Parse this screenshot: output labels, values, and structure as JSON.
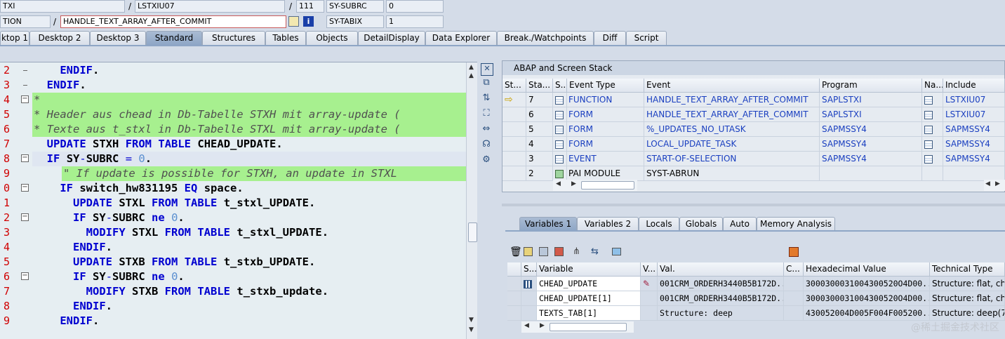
{
  "header": {
    "row1": {
      "f1": "TXI",
      "sep1": "/",
      "f2": "LSTXIU07",
      "sep2": "/",
      "f3": "111",
      "f4": "SY-SUBRC",
      "f5": "0"
    },
    "row2": {
      "f1": "TION",
      "sep1": "/",
      "f2": "HANDLE_TEXT_ARRAY_AFTER_COMMIT",
      "f4": "SY-TABIX",
      "f5": "1"
    }
  },
  "tabs": [
    "ktop 1",
    "Desktop 2",
    "Desktop 3",
    "Standard",
    "Structures",
    "Tables",
    "Objects",
    "DetailDisplay",
    "Data Explorer",
    "Break./Watchpoints",
    "Diff",
    "Script"
  ],
  "active_tab": "Standard",
  "editor": {
    "line_numbers": [
      "2",
      "3",
      "4",
      "5",
      "6",
      "7",
      "8",
      "9",
      "0",
      "1",
      "2",
      "3",
      "4",
      "5",
      "6",
      "7",
      "8",
      "9"
    ],
    "lines": [
      {
        "text": "    ENDIF."
      },
      {
        "text": "  ENDIF."
      },
      {
        "text": "*"
      },
      {
        "text": "* Header aus chead in Db-Tabelle STXH mit array-update ("
      },
      {
        "text": "* Texte aus t_stxl in Db-Tabelle STXL mit array-update ("
      },
      {
        "text": "  UPDATE STXH FROM TABLE CHEAD_UPDATE."
      },
      {
        "text": "  IF SY-SUBRC = 0."
      },
      {
        "text": "    \" If update is possible for STXH, an update in STXL"
      },
      {
        "text": "    IF switch_hw831195 EQ space."
      },
      {
        "text": "      UPDATE STXL FROM TABLE t_stxl_UPDATE."
      },
      {
        "text": "      IF SY-SUBRC ne 0."
      },
      {
        "text": "        MODIFY STXL FROM TABLE t_stxl_UPDATE."
      },
      {
        "text": "      ENDIF."
      },
      {
        "text": "      UPDATE STXB FROM TABLE t_stxb_UPDATE."
      },
      {
        "text": "      IF SY-SUBRC ne 0."
      },
      {
        "text": "        MODIFY STXB FROM TABLE t_stxb_update."
      },
      {
        "text": "      ENDIF."
      },
      {
        "text": "    ENDIF."
      }
    ]
  },
  "stack": {
    "title": "ABAP and Screen Stack",
    "headers": [
      "St...",
      "Sta...",
      "S...",
      "Event Type",
      "Event",
      "Program",
      "Na...",
      "Include"
    ],
    "rows": [
      {
        "level": "7",
        "type": "FUNCTION",
        "event": "HANDLE_TEXT_ARRAY_AFTER_COMMIT",
        "program": "SAPLSTXI",
        "include": "LSTXIU07",
        "current": true
      },
      {
        "level": "6",
        "type": "FORM",
        "event": "HANDLE_TEXT_ARRAY_AFTER_COMMIT",
        "program": "SAPLSTXI",
        "include": "LSTXIU07"
      },
      {
        "level": "5",
        "type": "FORM",
        "event": "%_UPDATES_NO_UTASK",
        "program": "SAPMSSY4",
        "include": "SAPMSSY4"
      },
      {
        "level": "4",
        "type": "FORM",
        "event": "LOCAL_UPDATE_TASK",
        "program": "SAPMSSY4",
        "include": "SAPMSSY4"
      },
      {
        "level": "3",
        "type": "EVENT",
        "event": "START-OF-SELECTION",
        "program": "SAPMSSY4",
        "include": "SAPMSSY4"
      },
      {
        "level": "2",
        "type": "PAI MODULE",
        "event": "SYST-ABRUN",
        "program": "",
        "include": ""
      }
    ]
  },
  "var_tabs": [
    "Variables 1",
    "Variables 2",
    "Locals",
    "Globals",
    "Auto",
    "Memory Analysis"
  ],
  "variables": {
    "headers": [
      "S...",
      "Variable",
      "V...",
      "Val.",
      "C...",
      "Hexadecimal Value",
      "Technical Type"
    ],
    "rows": [
      {
        "name": "CHEAD_UPDATE",
        "val": "001CRM_ORDERH3440B5B172D...",
        "hex": "3000300031004300520O4D00...",
        "type": "Structure: flat, ch"
      },
      {
        "name": "CHEAD_UPDATE[1]",
        "val": "001CRM_ORDERH3440B5B172D...",
        "hex": "3000300031004300520O4D00...",
        "type": "Structure: flat, ch"
      },
      {
        "name": "TEXTS_TAB[1]",
        "val": "Structure: deep",
        "hex": "430052004D005F004F005200...",
        "type": "Structure: deep(7"
      }
    ]
  },
  "watermark": "@稀土掘金技术社区"
}
